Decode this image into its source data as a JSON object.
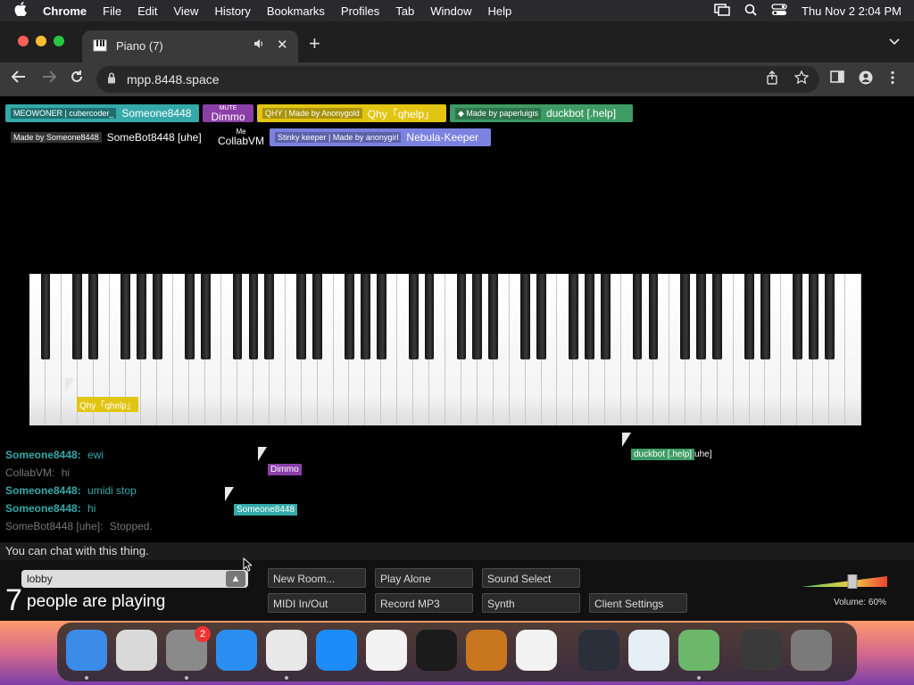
{
  "menubar": {
    "app": "Chrome",
    "items": [
      "File",
      "Edit",
      "View",
      "History",
      "Bookmarks",
      "Profiles",
      "Tab",
      "Window",
      "Help"
    ],
    "clock": "Thu Nov 2  2:04 PM"
  },
  "tab": {
    "title": "Piano (7)"
  },
  "url": {
    "value": "mpp.8448.space"
  },
  "tags": [
    {
      "sub": "MEOWONER | cubercoder_",
      "name": "Someone8448",
      "color": "#35a9a9"
    },
    {
      "sub": "MUTE",
      "name": "Dimmo",
      "color": "#8a3fa7"
    },
    {
      "sub": "QHY | Made by Anonygold",
      "name": "Qhy「qhelp」",
      "color": "#e2c512"
    },
    {
      "sub": "Made by paperluigis",
      "name": "duckbot [.help]",
      "color": "#3e9b64"
    },
    {
      "sub": "Made by Someone8448",
      "name": "SomeBot8448 [uhe]",
      "color": "#000000"
    },
    {
      "sub": "Me",
      "name": "CollabVM",
      "color": "#000000"
    },
    {
      "sub": "Stinky keeper | Made by anonygirl",
      "name": "Nebula-Keeper",
      "color": "#7b82e0"
    }
  ],
  "cursors": [
    {
      "label": "Qhy「qhelp」",
      "color": "#e2c512"
    },
    {
      "label": "Dimmo",
      "color": "#8a3fa7"
    },
    {
      "label": "Someone8448",
      "color": "#35a9a9"
    },
    {
      "label": "duckbot [.help]",
      "suffix": "uhe]",
      "color": "#3e9b64"
    }
  ],
  "chat": [
    {
      "name": "Someone8448:",
      "msg": "ewi",
      "color": "#35a9a9"
    },
    {
      "name": "CollabVM:",
      "msg": "hi",
      "color": "#777777"
    },
    {
      "name": "Someone8448:",
      "msg": "umidi stop",
      "color": "#35a9a9"
    },
    {
      "name": "Someone8448:",
      "msg": "hi",
      "color": "#35a9a9"
    },
    {
      "name": "SomeBot8448 [uhe]:",
      "msg": "Stopped.",
      "color": "#777777"
    }
  ],
  "chat_input": {
    "placeholder": "You can chat with this thing."
  },
  "room": {
    "name": "lobby",
    "count": "7",
    "playing": "people are playing"
  },
  "buttons": {
    "new_room": "New Room...",
    "play_alone": "Play Alone",
    "sound_select": "Sound Select",
    "midi": "MIDI In/Out",
    "record": "Record MP3",
    "synth": "Synth",
    "client_settings": "Client Settings"
  },
  "volume": {
    "label": "Volume: 60%",
    "value": 0.6
  },
  "dock": [
    {
      "name": "finder",
      "color": "#3b8be8"
    },
    {
      "name": "launchpad",
      "color": "#d9d9d9"
    },
    {
      "name": "system-settings",
      "color": "#8a8a8a",
      "badge": "2"
    },
    {
      "name": "safari",
      "color": "#2a8ef0"
    },
    {
      "name": "chrome",
      "color": "#e8e8e8"
    },
    {
      "name": "app-store",
      "color": "#1d8cf8"
    },
    {
      "name": "textedit",
      "color": "#f2f2f2"
    },
    {
      "name": "terminal",
      "color": "#1b1b1b"
    },
    {
      "name": "garageband",
      "color": "#c8771f"
    },
    {
      "name": "vscode",
      "color": "#f2f2f2"
    },
    {
      "name": "nox",
      "color": "#2a2f3a"
    },
    {
      "name": "preview",
      "color": "#e6eef6"
    },
    {
      "name": "flask-app",
      "color": "#6bb86b"
    },
    {
      "name": "downloads-stack",
      "color": "#3a3a3a"
    },
    {
      "name": "trash",
      "color": "#7a7a7a"
    }
  ]
}
